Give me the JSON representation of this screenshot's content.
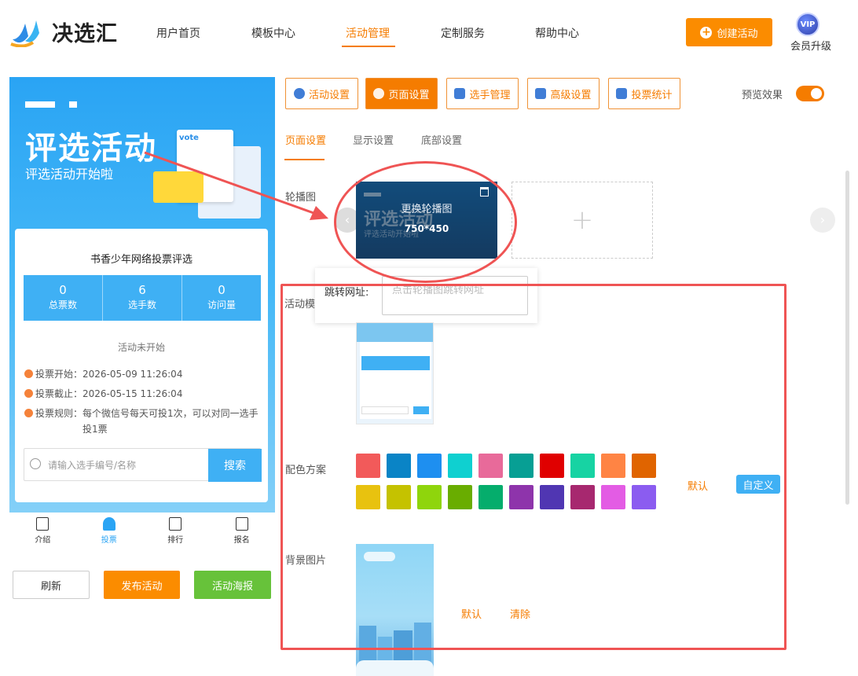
{
  "header": {
    "brand": "决选汇",
    "nav": [
      "用户首页",
      "模板中心",
      "活动管理",
      "定制服务",
      "帮助中心"
    ],
    "active_nav": "活动管理",
    "create_label": "创建活动",
    "vip_badge": "VIP",
    "vip_label": "会员升级"
  },
  "phone": {
    "banner_title": "评选活动",
    "banner_subtitle": "评选活动开始啦",
    "banner_vote": "vote",
    "activity_title": "书香少年网络投票评选",
    "stats": [
      {
        "num": "0",
        "label": "总票数"
      },
      {
        "num": "6",
        "label": "选手数"
      },
      {
        "num": "0",
        "label": "访问量"
      }
    ],
    "status": "活动未开始",
    "vote_start": "投票开始：2026-05-09 11:26:04",
    "vote_end": "投票截止：2026-05-15 11:26:04",
    "rule_line1": "投票规则：每个微信号每天可投1次，可以对同一选手",
    "rule_line2": "投1票",
    "search_placeholder": "请输入选手编号/名称",
    "search_button": "搜索",
    "tabs": [
      "介绍",
      "投票",
      "排行",
      "报名"
    ],
    "active_tab": "投票"
  },
  "actions": {
    "refresh": "刷新",
    "publish": "发布活动",
    "poster": "活动海报"
  },
  "toolbar": {
    "buttons": [
      "活动设置",
      "页面设置",
      "选手管理",
      "高级设置",
      "投票统计"
    ],
    "active": "页面设置",
    "preview_label": "预览效果"
  },
  "subtabs": [
    "页面设置",
    "显示设置",
    "底部设置"
  ],
  "form": {
    "carousel_label": "轮播图",
    "change_carousel": "更换轮播图",
    "carousel_size": "750*450",
    "jump_label": "跳转网址:",
    "jump_placeholder": "点击轮播图跳转网址",
    "template_label": "活动模",
    "color_label": "配色方案",
    "color_default": "默认",
    "color_custom": "自定义",
    "colors": [
      "#f25a5a",
      "#0a84c6",
      "#1e8ff0",
      "#0fd0d0",
      "#e86a9a",
      "#079f94",
      "#e00000",
      "#17d3a3",
      "#ff8444",
      "#e06400",
      "#e8c20f",
      "#c5c200",
      "#8fd50c",
      "#69ad00",
      "#05ad6c",
      "#8e34ab",
      "#5036b2",
      "#a7286f",
      "#e35ce4",
      "#8b5cf0"
    ],
    "bg_label": "背景图片",
    "bg_default": "默认",
    "bg_clear": "清除"
  },
  "colors": {
    "accent": "#f57c00",
    "blue": "#3fb0f4",
    "green": "#67c23a",
    "annotation_red": "#ef5454"
  }
}
